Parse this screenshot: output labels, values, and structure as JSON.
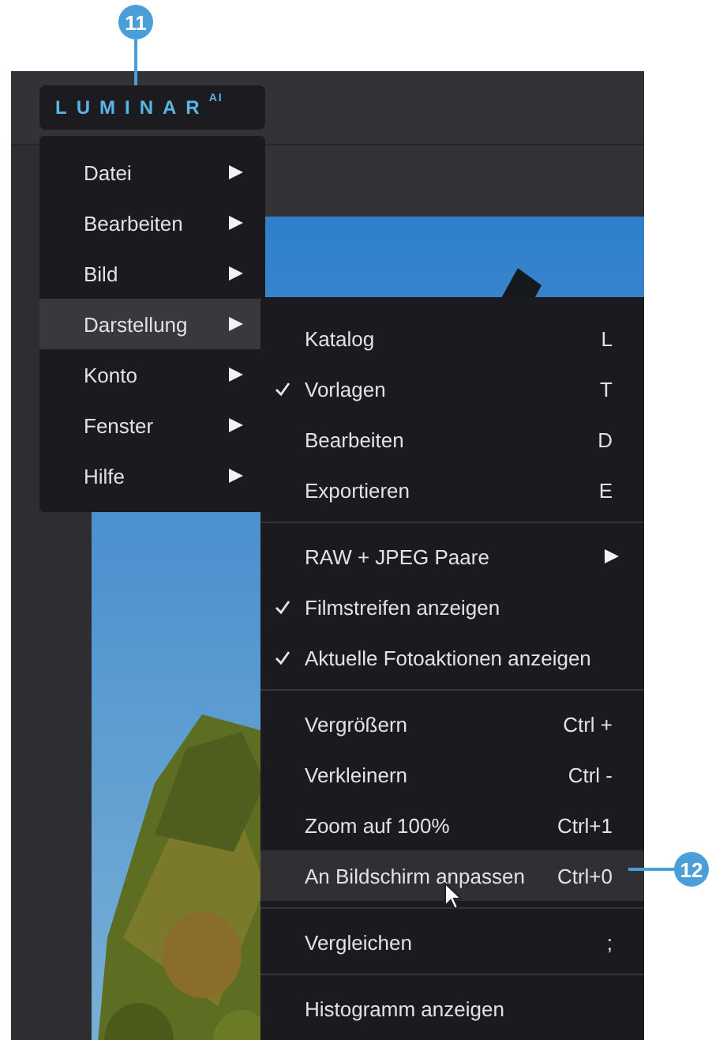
{
  "callouts": [
    {
      "number": "11"
    },
    {
      "number": "12"
    }
  ],
  "logo": {
    "text": "LUMINAR",
    "superscript": "AI"
  },
  "main_menu": {
    "items": [
      {
        "label": "Datei",
        "selected": false
      },
      {
        "label": "Bearbeiten",
        "selected": false
      },
      {
        "label": "Bild",
        "selected": false
      },
      {
        "label": "Darstellung",
        "selected": true
      },
      {
        "label": "Konto",
        "selected": false
      },
      {
        "label": "Fenster",
        "selected": false
      },
      {
        "label": "Hilfe",
        "selected": false
      }
    ]
  },
  "submenu": {
    "groups": [
      [
        {
          "label": "Katalog",
          "shortcut": "L",
          "checked": false,
          "has_submenu": false,
          "selected": false
        },
        {
          "label": "Vorlagen",
          "shortcut": "T",
          "checked": true,
          "has_submenu": false,
          "selected": false
        },
        {
          "label": "Bearbeiten",
          "shortcut": "D",
          "checked": false,
          "has_submenu": false,
          "selected": false
        },
        {
          "label": "Exportieren",
          "shortcut": "E",
          "checked": false,
          "has_submenu": false,
          "selected": false
        }
      ],
      [
        {
          "label": "RAW + JPEG Paare",
          "checked": false,
          "has_submenu": true,
          "selected": false
        },
        {
          "label": "Filmstreifen anzeigen",
          "checked": true,
          "has_submenu": false,
          "selected": false
        },
        {
          "label": "Aktuelle Fotoaktionen anzeigen",
          "checked": true,
          "has_submenu": false,
          "selected": false
        }
      ],
      [
        {
          "label": "Vergrößern",
          "shortcut": "Ctrl +",
          "checked": false,
          "has_submenu": false,
          "selected": false
        },
        {
          "label": "Verkleinern",
          "shortcut": "Ctrl -",
          "checked": false,
          "has_submenu": false,
          "selected": false
        },
        {
          "label": "Zoom auf 100%",
          "shortcut": "Ctrl+1",
          "checked": false,
          "has_submenu": false,
          "selected": false
        },
        {
          "label": "An Bildschirm anpassen",
          "shortcut": "Ctrl+0",
          "checked": false,
          "has_submenu": false,
          "selected": true
        }
      ],
      [
        {
          "label": "Vergleichen",
          "shortcut": ";",
          "checked": false,
          "has_submenu": false,
          "selected": false
        }
      ],
      [
        {
          "label": "Histogramm anzeigen",
          "checked": false,
          "has_submenu": false,
          "selected": false
        }
      ]
    ]
  }
}
